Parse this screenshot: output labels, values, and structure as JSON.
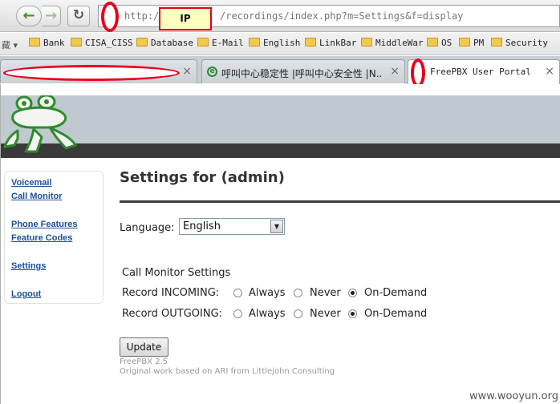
{
  "browser": {
    "url_prefix": "http://",
    "url_path": "/recordings/index.php?m=Settings&f=display",
    "ip_label": "IP",
    "bookmarks_lead": "藏 ▾",
    "bookmarks": [
      "Bank",
      "CISA_CISS",
      "Database",
      "E-Mail",
      "English",
      "LinkBar",
      "MiddleWar",
      "OS",
      "PM",
      "Security"
    ],
    "tabs": [
      {
        "title": "",
        "close": "×"
      },
      {
        "title": "呼叫中心稳定性 |呼叫中心安全性 |N...",
        "close": "×"
      },
      {
        "title": "FreePBX User Portal",
        "close": "×"
      }
    ]
  },
  "sidebar": {
    "items": [
      "Voicemail",
      "Call Monitor",
      "Phone Features",
      "Feature Codes",
      "Settings",
      "Logout"
    ]
  },
  "main": {
    "title": "Settings for (admin)",
    "language_label": "Language:",
    "language_value": "English",
    "call_monitor_heading": "Call Monitor Settings",
    "incoming_label": "Record INCOMING:",
    "outgoing_label": "Record OUTGOING:",
    "options": [
      "Always",
      "Never",
      "On-Demand"
    ],
    "incoming_selected": "On-Demand",
    "outgoing_selected": "On-Demand",
    "update_label": "Update",
    "version": "FreePBX 2.5",
    "credit": "Original work based on ARI from Littlejohn Consulting"
  },
  "watermark": "www.wooyun.org"
}
